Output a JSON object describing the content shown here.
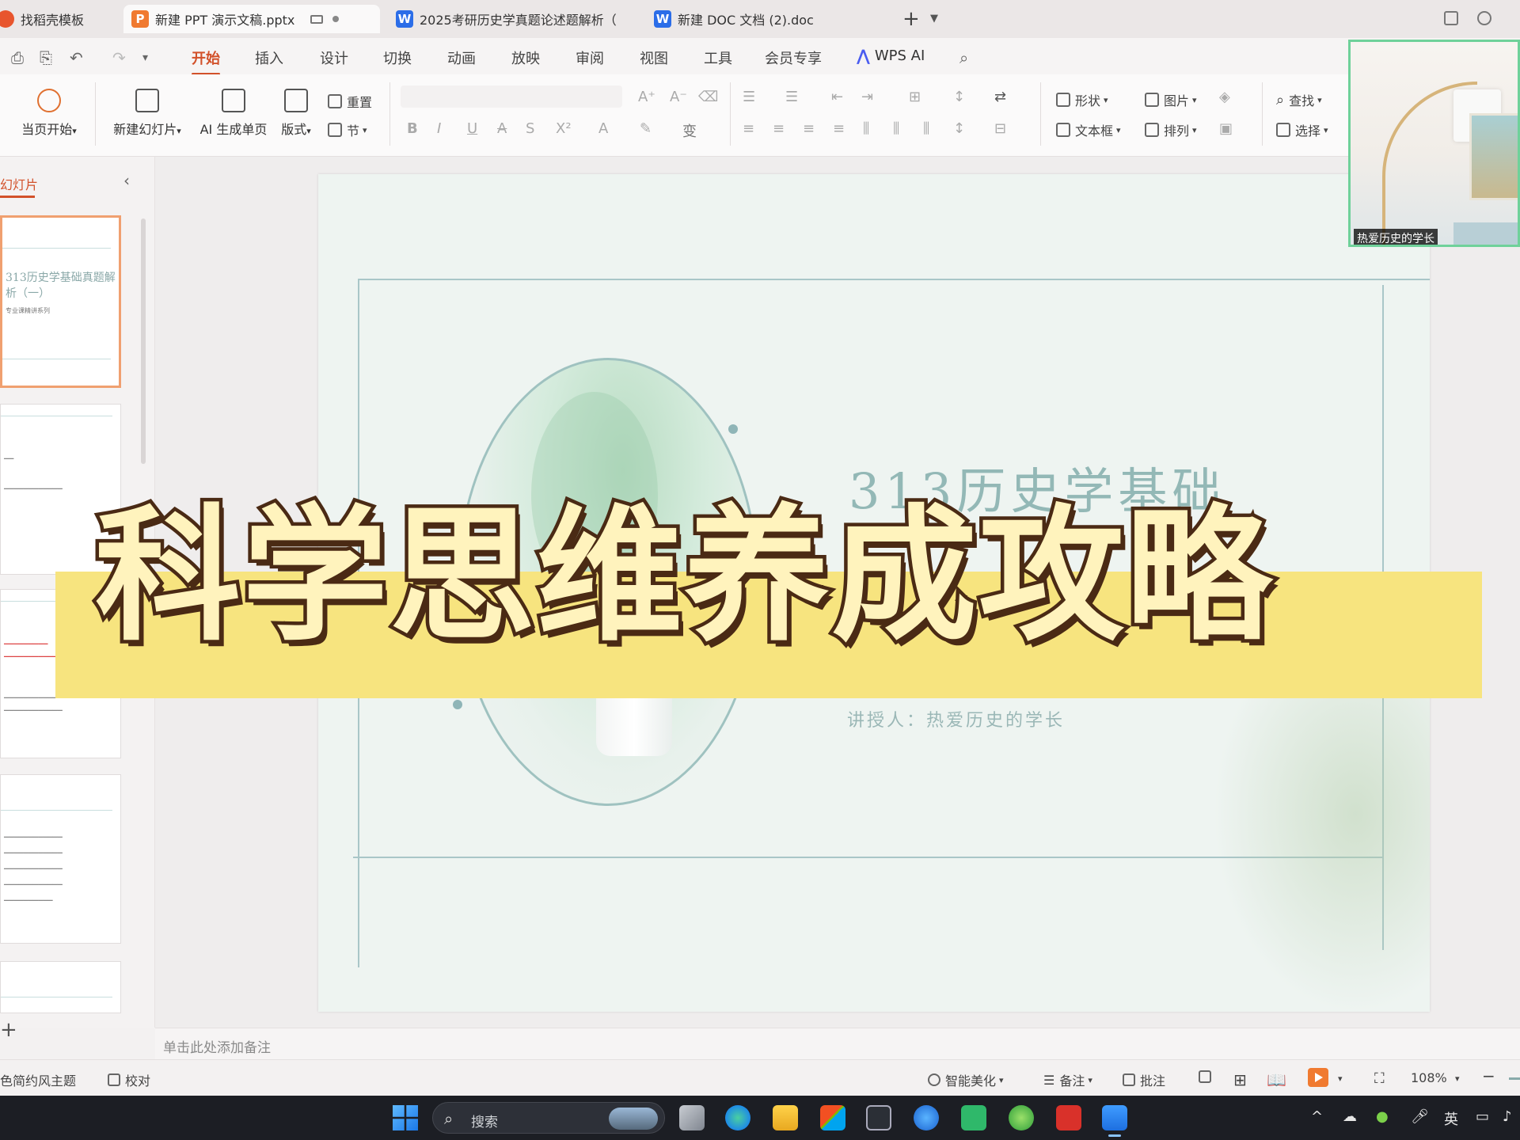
{
  "tabs": [
    {
      "label": "找稻壳模板",
      "icon": "docer-icon",
      "color": "#e8552d"
    },
    {
      "label": "新建 PPT 演示文稿.pptx",
      "icon": "ppt-icon",
      "color": "#f07a30"
    },
    {
      "label": "2025考研历史学真题论述题解析（",
      "icon": "word-icon",
      "color": "#2b6de8"
    },
    {
      "label": "新建 DOC 文档 (2).doc",
      "icon": "word-icon",
      "color": "#2b6de8"
    }
  ],
  "tab_letters": {
    "ppt": "P",
    "word": "W"
  },
  "tab_add_label": "+",
  "menu": [
    "开始",
    "插入",
    "设计",
    "切换",
    "动画",
    "放映",
    "审阅",
    "视图",
    "工具",
    "会员专享"
  ],
  "menu_active": "开始",
  "wps_ai_label": "WPS AI",
  "ribbon": {
    "play_from_current": "当页开始",
    "new_slide": "新建幻灯片",
    "ai_generate": "AI 生成单页",
    "layout": "版式",
    "reset": "重置",
    "section": "节",
    "shape": "形状",
    "picture": "图片",
    "find": "查找",
    "textbox": "文本框",
    "arrange": "排列",
    "select": "选择"
  },
  "camera_label": "热爱历史的学长",
  "slides_panel_title": "幻灯片",
  "thumbnail1": {
    "title": "313历史学基础真题解析（一）",
    "subtitle": "专业课精讲系列"
  },
  "slide": {
    "title": "313历史学基础",
    "presenter": "讲授人：热爱历史的学长"
  },
  "overlay_title": "科学思维养成攻略",
  "notes_placeholder": "单击此处添加备注",
  "status": {
    "theme": "色简约风主题",
    "proofread": "校对",
    "smart_beautify": "智能美化",
    "notes": "备注",
    "comments": "批注",
    "zoom": "108%"
  },
  "taskbar": {
    "search_placeholder": "搜索",
    "ime": "英"
  },
  "colors": {
    "accent": "#d2512a",
    "overlay_fill": "#fff3bd",
    "overlay_stroke": "#4a2a14",
    "band": "#f7e47f",
    "slide_bg": "#eef4f1"
  }
}
